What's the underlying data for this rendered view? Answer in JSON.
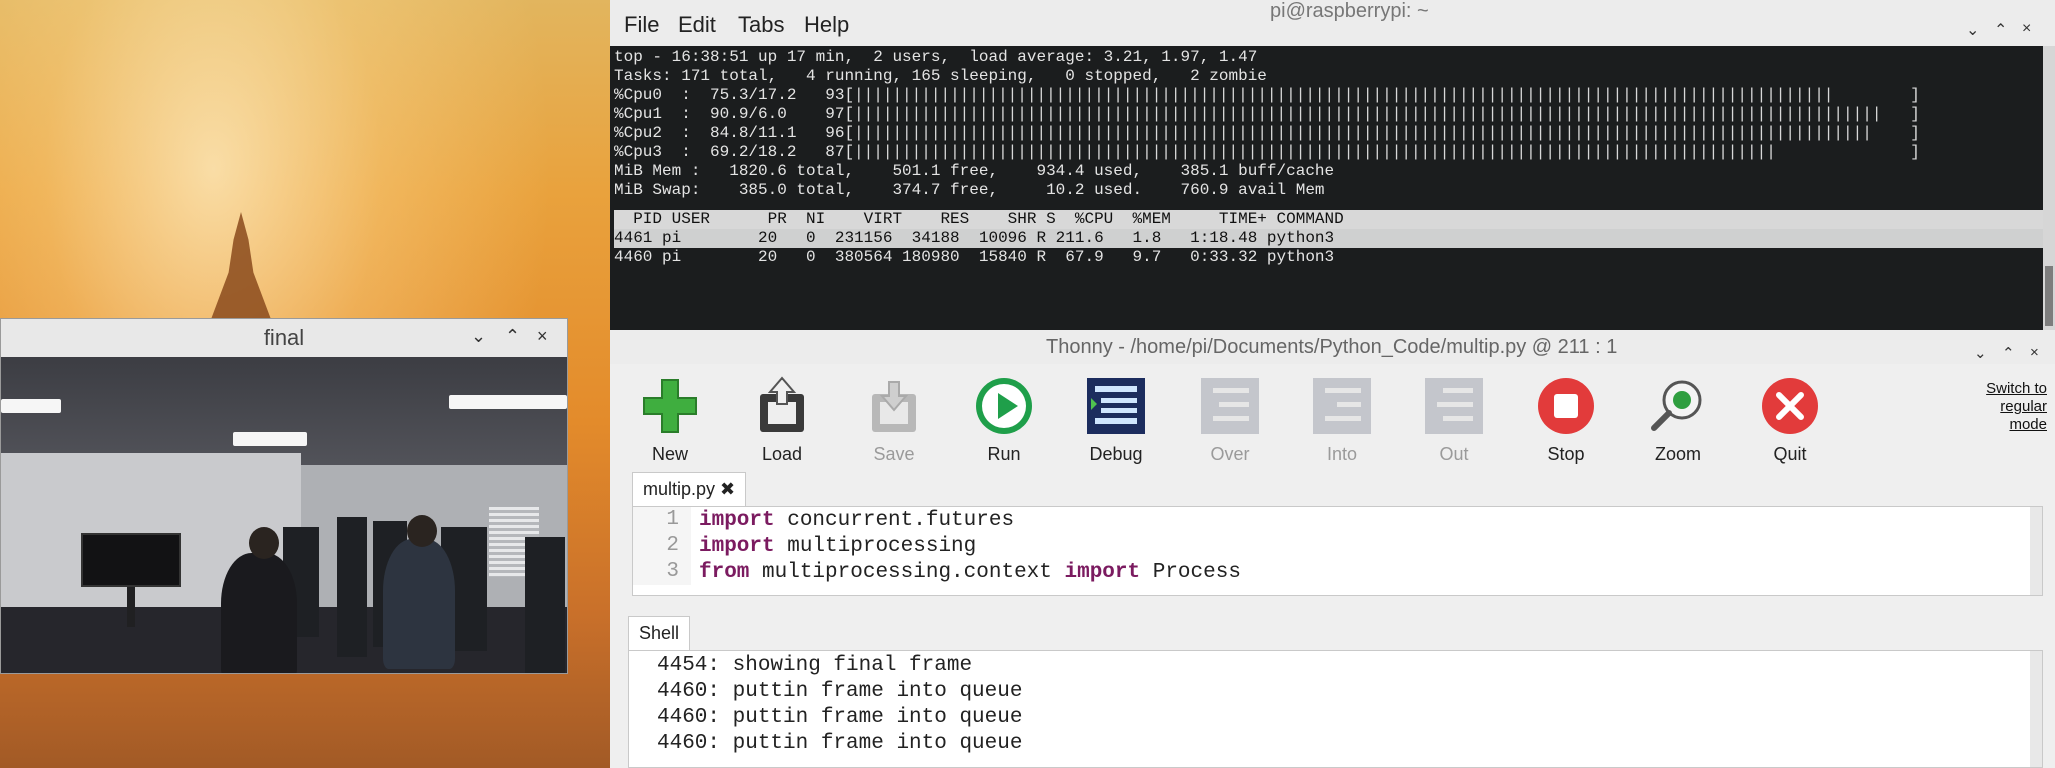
{
  "final_window": {
    "title": "final",
    "controls": [
      "⌄",
      "⌃",
      "×"
    ]
  },
  "terminal": {
    "title": "pi@raspberrypi: ~",
    "menu": [
      "File",
      "Edit",
      "Tabs",
      "Help"
    ],
    "controls": [
      "⌄",
      "⌃",
      "×"
    ],
    "summary": [
      "top - 16:38:51 up 17 min,  2 users,  load average: 3.21, 1.97, 1.47",
      "Tasks: 171 total,   4 running, 165 sleeping,   0 stopped,   2 zombie"
    ],
    "cpus": [
      {
        "label": "%Cpu0  :  75.3/17.2   93[",
        "percent": 93
      },
      {
        "label": "%Cpu1  :  90.9/6.0    97[",
        "percent": 97
      },
      {
        "label": "%Cpu2  :  84.8/11.1   96[",
        "percent": 96
      },
      {
        "label": "%Cpu3  :  69.2/18.2   87[",
        "percent": 87
      }
    ],
    "mem_lines": [
      "MiB Mem :   1820.6 total,    501.1 free,    934.4 used,    385.1 buff/cache",
      "MiB Swap:    385.0 total,    374.7 free,     10.2 used.    760.9 avail Mem"
    ],
    "proc_header": "  PID USER      PR  NI    VIRT    RES    SHR S  %CPU  %MEM     TIME+ COMMAND",
    "processes": [
      "4461 pi        20   0  231156  34188  10096 R 211.6   1.8   1:18.48 python3",
      "4460 pi        20   0  380564 180980  15840 R  67.9   9.7   0:33.32 python3"
    ]
  },
  "thonny": {
    "title": "Thonny  -  /home/pi/Documents/Python_Code/multip.py  @  211 : 1",
    "controls": [
      "⌄",
      "⌃",
      "×"
    ],
    "toolbar": [
      {
        "label": "New",
        "icon": "new-icon",
        "enabled": true
      },
      {
        "label": "Load",
        "icon": "load-icon",
        "enabled": true
      },
      {
        "label": "Save",
        "icon": "save-icon",
        "enabled": false
      },
      {
        "label": "Run",
        "icon": "run-icon",
        "enabled": true
      },
      {
        "label": "Debug",
        "icon": "debug-icon",
        "enabled": true
      },
      {
        "label": "Over",
        "icon": "step-over-icon",
        "enabled": false
      },
      {
        "label": "Into",
        "icon": "step-into-icon",
        "enabled": false
      },
      {
        "label": "Out",
        "icon": "step-out-icon",
        "enabled": false
      },
      {
        "label": "Stop",
        "icon": "stop-icon",
        "enabled": true
      },
      {
        "label": "Zoom",
        "icon": "zoom-icon",
        "enabled": true
      },
      {
        "label": "Quit",
        "icon": "quit-icon",
        "enabled": true
      }
    ],
    "switch_mode": [
      "Switch to",
      "regular",
      "mode"
    ],
    "editor_tab": "multip.py ✖",
    "code": [
      {
        "num": "1",
        "kw": "import",
        "rest": " concurrent.futures"
      },
      {
        "num": "2",
        "kw": "import",
        "rest": " multiprocessing"
      },
      {
        "num": "3",
        "kw": "from",
        "rest": " multiprocessing.context ",
        "kw2": "import",
        "rest2": " Process"
      }
    ],
    "shell_tab": "Shell",
    "shell_lines": [
      "4454: showing final frame",
      "4460: puttin frame into queue",
      "4460: puttin frame into queue",
      "4460: puttin frame into queue"
    ]
  }
}
